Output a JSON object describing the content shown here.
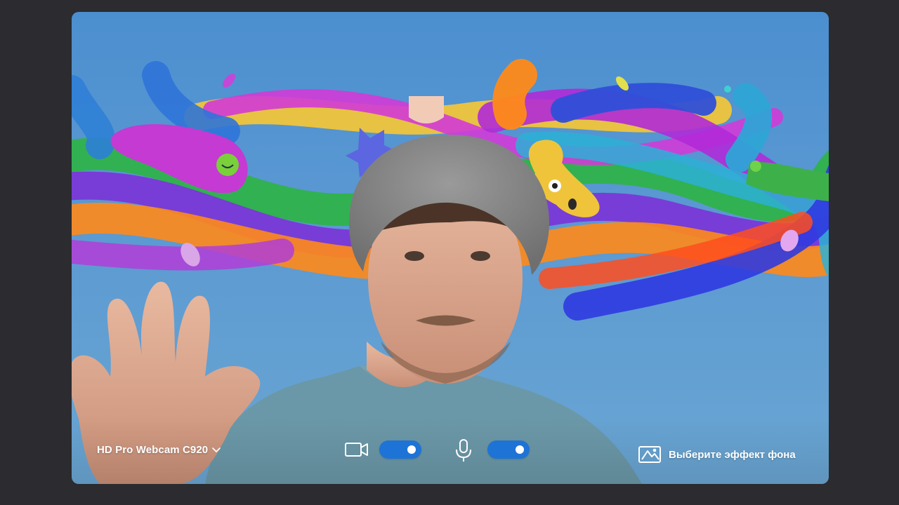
{
  "camera": {
    "device_label": "HD Pro Webcam C920",
    "video_enabled": true,
    "mic_enabled": true
  },
  "background_effect": {
    "label": "Выберите эффект фона"
  },
  "icons": {
    "camera": "video-camera-icon",
    "mic": "microphone-icon",
    "effect": "background-effect-icon",
    "dropdown": "chevron-down-icon"
  },
  "colors": {
    "toggle_on": "#1e73d6",
    "page_bg": "#2b2b30"
  }
}
